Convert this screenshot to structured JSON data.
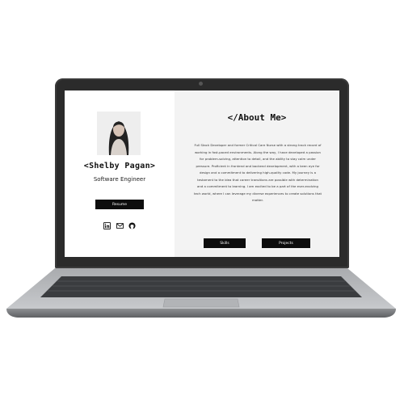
{
  "profile": {
    "name": "<Shelby Pagan>",
    "role": "Software Engineer",
    "resume_label": "Resume"
  },
  "social": {
    "icons": [
      "linkedin-icon",
      "email-icon",
      "github-icon"
    ]
  },
  "about": {
    "title": "</About Me>",
    "bio": "Full Stack Developer and former Critical Care Nurse with a strong track record of working in fast-paced environments. Along the way, I have developed a passion for problem-solving, attention to detail, and the ability to stay calm under pressure. Proficient in frontend and backend development, with a keen eye for design and a commitment to delivering high-quality code. My journey is a testament to the idea that career transitions are possible with determination and a commitment to learning. I am excited to be a part of the ever-evolving tech world, where I can leverage my diverse experiences to create solutions that matter.",
    "skills_label": "Skills",
    "projects_label": "Projects"
  },
  "colors": {
    "laptop_frame": "#2b2b2b",
    "left_bg": "#ffffff",
    "right_bg": "#f3f3f3",
    "button_bg": "#0d0d0d",
    "button_text": "#ffffff"
  }
}
